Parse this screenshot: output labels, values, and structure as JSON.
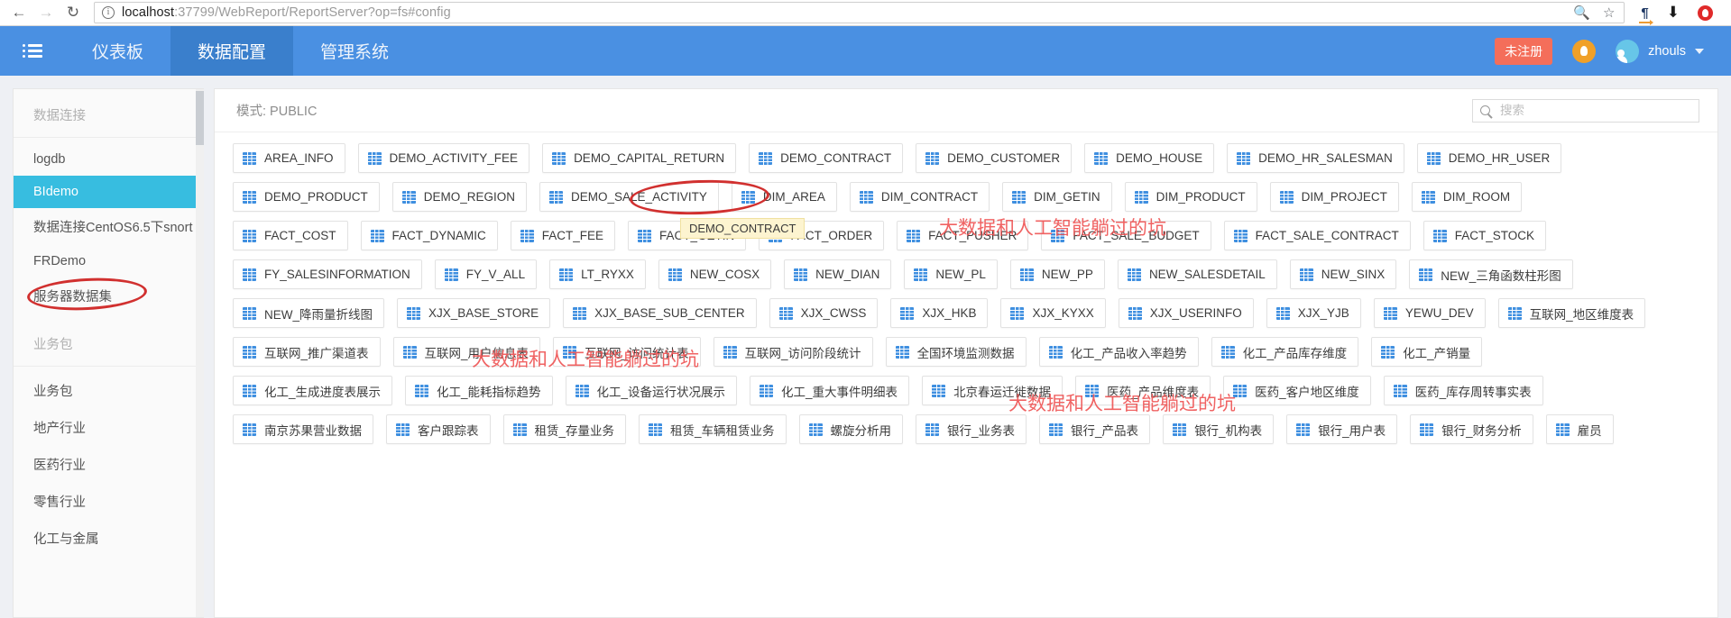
{
  "browser": {
    "back_icon": "back-arrow-icon",
    "forward_icon": "forward-arrow-icon",
    "reload_icon": "reload-icon",
    "url_prefix": "localhost",
    "url_rest": ":37799/WebReport/ReportServer?op=fs#config",
    "url_full": "localhost:37799/WebReport/ReportServer?op=fs#config",
    "zoom_out_icon": "zoom-out-icon",
    "bookmark_icon": "star-icon",
    "pilcrow_icon": "pilcrow-translate-icon",
    "download_icon": "download-icon",
    "opera_icon": "opera-menu-icon"
  },
  "header": {
    "menu_icon": "hamburger-menu-icon",
    "tabs": [
      {
        "label": "仪表板",
        "active": false
      },
      {
        "label": "数据配置",
        "active": true
      },
      {
        "label": "管理系统",
        "active": false
      }
    ],
    "unregistered_badge": "未注册",
    "bell_icon": "notification-bell-icon",
    "avatar_icon": "user-avatar-icon",
    "username": "zhouls",
    "caret_icon": "chevron-down-icon",
    "accent_color": "#4a90e2",
    "active_tab_color": "#3a7fcc",
    "badge_color": "#f46e5a"
  },
  "sidebar": {
    "groups": [
      {
        "title": "数据连接",
        "items": [
          {
            "label": "logdb",
            "selected": false
          },
          {
            "label": "BIdemo",
            "selected": true
          },
          {
            "label": "数据连接CentOS6.5下snort",
            "selected": false
          },
          {
            "label": "FRDemo",
            "selected": false
          },
          {
            "label": "服务器数据集",
            "selected": false
          }
        ]
      },
      {
        "title": "业务包",
        "items": [
          {
            "label": "业务包",
            "selected": false
          },
          {
            "label": "地产行业",
            "selected": false
          },
          {
            "label": "医药行业",
            "selected": false
          },
          {
            "label": "零售行业",
            "selected": false
          },
          {
            "label": "化工与金属",
            "selected": false
          }
        ]
      }
    ],
    "selected_color": "#37bde0"
  },
  "main": {
    "schema_label": "模式: PUBLIC",
    "search": {
      "placeholder": "搜索",
      "value": "",
      "icon": "search-icon"
    },
    "tooltip": "DEMO_CONTRACT",
    "table_icon": "table-grid-icon",
    "rows": [
      [
        "AREA_INFO",
        "DEMO_ACTIVITY_FEE",
        "DEMO_CAPITAL_RETURN",
        "DEMO_CONTRACT",
        "DEMO_CUSTOMER",
        "DEMO_HOUSE",
        "DEMO_HR_SALESMAN",
        "DEMO_HR_USER"
      ],
      [
        "DEMO_PRODUCT",
        "DEMO_REGION",
        "DEMO_SALE_ACTIVITY",
        "DIM_AREA",
        "DIM_CONTRACT",
        "DIM_GETIN",
        "DIM_PRODUCT",
        "DIM_PROJECT",
        "DIM_ROOM"
      ],
      [
        "FACT_COST",
        "FACT_DYNAMIC",
        "FACT_FEE",
        "FACT_GETIN",
        "FACT_ORDER",
        "FACT_PUSHER",
        "FACT_SALE_BUDGET",
        "FACT_SALE_CONTRACT",
        "FACT_STOCK"
      ],
      [
        "FY_SALESINFORMATION",
        "FY_V_ALL",
        "LT_RYXX",
        "NEW_COSX",
        "NEW_DIAN",
        "NEW_PL",
        "NEW_PP",
        "NEW_SALESDETAIL",
        "NEW_SINX",
        "NEW_三角函数柱形图"
      ],
      [
        "NEW_降雨量折线图",
        "XJX_BASE_STORE",
        "XJX_BASE_SUB_CENTER",
        "XJX_CWSS",
        "XJX_HKB",
        "XJX_KYXX",
        "XJX_USERINFO",
        "XJX_YJB",
        "YEWU_DEV",
        "互联网_地区维度表"
      ],
      [
        "互联网_推广渠道表",
        "互联网_用户信息表",
        "互联网_访问统计表",
        "互联网_访问阶段统计",
        "全国环境监测数据",
        "化工_产品收入率趋势",
        "化工_产品库存维度",
        "化工_产销量"
      ],
      [
        "化工_生成进度表展示",
        "化工_能耗指标趋势",
        "化工_设备运行状况展示",
        "化工_重大事件明细表",
        "北京春运迁徙数据",
        "医药_产品维度表",
        "医药_客户地区维度",
        "医药_库存周转事实表"
      ],
      [
        "南京苏果营业数据",
        "客户跟踪表",
        "租赁_存量业务",
        "租赁_车辆租赁业务",
        "螺旋分析用",
        "银行_业务表",
        "银行_产品表",
        "银行_机构表",
        "银行_用户表",
        "银行_财务分析",
        "雇员"
      ]
    ],
    "highlighted_table": "DEMO_CONTRACT"
  },
  "annotations": {
    "watermark_text": "大数据和人工智能躺过的坑",
    "watermark_color": "#ef5656",
    "ellipse_color": "#d1302f",
    "circled_sidebar_item": "BIdemo",
    "circled_table": "DEMO_CONTRACT"
  }
}
